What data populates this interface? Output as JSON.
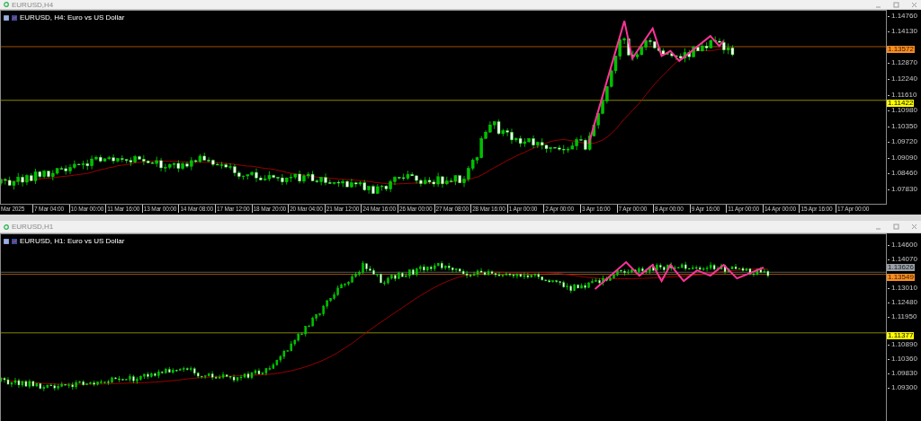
{
  "windows": [
    {
      "title": "EURUSD,H4",
      "chart_label": "EURUSD, H4:  Euro vs US Dollar",
      "price_ticks": [
        "1.14760",
        "1.14130",
        "1.12870",
        "1.12240",
        "1.11610",
        "1.10980",
        "1.10350",
        "1.09720",
        "1.09090",
        "1.08460",
        "1.07830"
      ],
      "price_markers": [
        {
          "kind": "ask",
          "text": "1.13572"
        },
        {
          "kind": "level",
          "text": "1.11422"
        }
      ],
      "time_labels": [
        "Mar 2025",
        "7 Mar 04:00",
        "10 Mar 00:00",
        "11 Mar 16:00",
        "13 Mar 00:00",
        "14 Mar 08:00",
        "17 Mar 12:00",
        "18 Mar 20:00",
        "20 Mar 04:00",
        "21 Mar 12:00",
        "24 Mar 16:00",
        "26 Mar 00:00",
        "27 Mar 08:00",
        "28 Mar 16:00",
        "1 Apr 00:00",
        "2 Apr 00:00",
        "3 Apr 16:00",
        "7 Apr 00:00",
        "8 Apr 00:00",
        "9 Apr 16:00",
        "11 Apr 00:00",
        "14 Apr 00:00",
        "15 Apr 16:00",
        "17 Apr 00:00"
      ]
    },
    {
      "title": "EURUSD,H1",
      "chart_label": "EURUSD, H1:  Euro vs US Dollar",
      "price_ticks": [
        "1.14600",
        "1.14070",
        "1.13010",
        "1.12480",
        "1.11950",
        "1.10890",
        "1.10360",
        "1.09830",
        "1.09300"
      ],
      "price_markers": [
        {
          "kind": "bid",
          "text": "1.13626"
        },
        {
          "kind": "ask",
          "text": "1.13549"
        },
        {
          "kind": "level",
          "text": "1.11377"
        }
      ]
    }
  ]
}
